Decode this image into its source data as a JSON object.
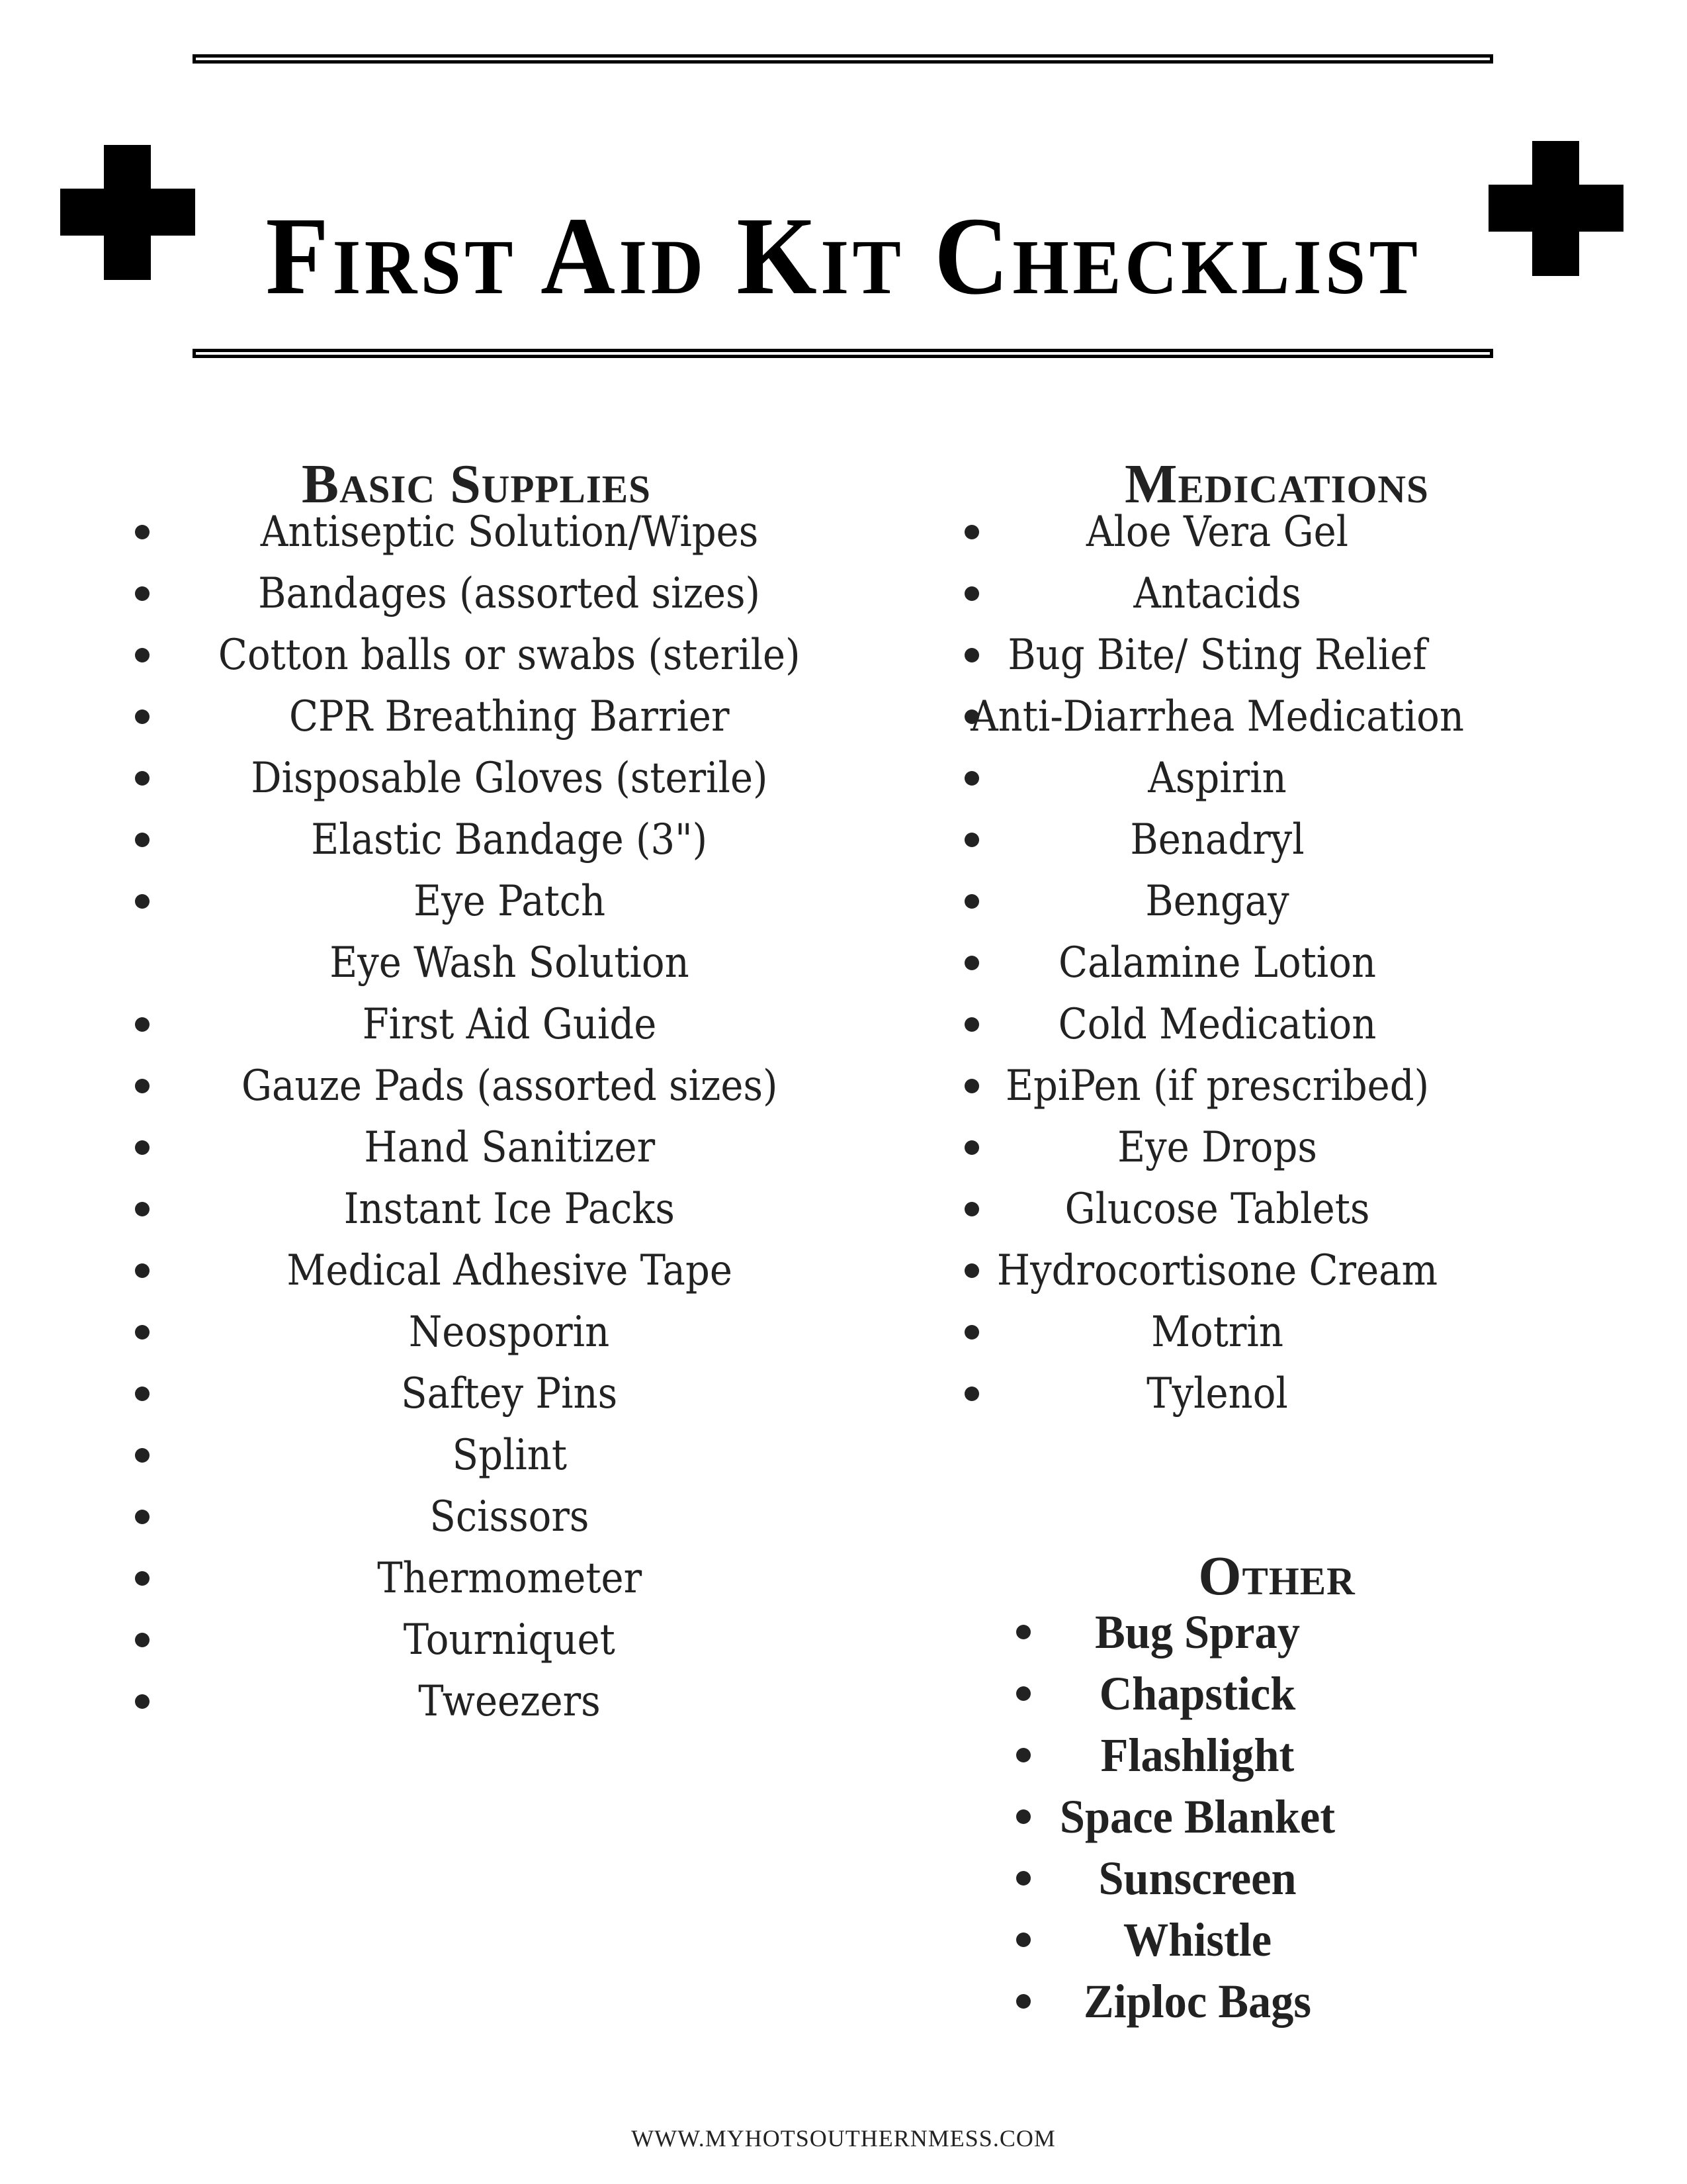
{
  "document": {
    "title": "First Aid Kit Checklist",
    "footer_url": "WWW.MYHOTSOUTHERNMESS.COM",
    "icons": {
      "left": "cross-icon",
      "right": "cross-icon"
    }
  },
  "sections": {
    "basic_supplies": {
      "heading": "Basic Supplies",
      "items": [
        {
          "label": "Antiseptic Solution/Wipes",
          "bullet": true
        },
        {
          "label": "Bandages (assorted sizes)",
          "bullet": true
        },
        {
          "label": "Cotton balls or swabs (sterile)",
          "bullet": true
        },
        {
          "label": "CPR Breathing Barrier",
          "bullet": true
        },
        {
          "label": "Disposable Gloves (sterile)",
          "bullet": true
        },
        {
          "label": "Elastic Bandage (3\")",
          "bullet": true
        },
        {
          "label": "Eye Patch",
          "bullet": true
        },
        {
          "label": "Eye Wash Solution",
          "bullet": false
        },
        {
          "label": "First Aid Guide",
          "bullet": true
        },
        {
          "label": "Gauze Pads (assorted sizes)",
          "bullet": true
        },
        {
          "label": "Hand Sanitizer",
          "bullet": true
        },
        {
          "label": "Instant Ice Packs",
          "bullet": true
        },
        {
          "label": "Medical Adhesive Tape",
          "bullet": true
        },
        {
          "label": "Neosporin",
          "bullet": true
        },
        {
          "label": "Saftey Pins",
          "bullet": true
        },
        {
          "label": "Splint",
          "bullet": true
        },
        {
          "label": "Scissors",
          "bullet": true
        },
        {
          "label": "Thermometer",
          "bullet": true
        },
        {
          "label": "Tourniquet",
          "bullet": true
        },
        {
          "label": "Tweezers",
          "bullet": true
        }
      ]
    },
    "medications": {
      "heading": "Medications",
      "items": [
        {
          "label": "Aloe Vera Gel",
          "bullet": true
        },
        {
          "label": "Antacids",
          "bullet": true
        },
        {
          "label": "Bug Bite/ Sting Relief",
          "bullet": true
        },
        {
          "label": "Anti-Diarrhea Medication",
          "bullet": true
        },
        {
          "label": "Aspirin",
          "bullet": true
        },
        {
          "label": "Benadryl",
          "bullet": true
        },
        {
          "label": "Bengay",
          "bullet": true
        },
        {
          "label": "Calamine Lotion",
          "bullet": true
        },
        {
          "label": "Cold Medication",
          "bullet": true
        },
        {
          "label": "EpiPen (if prescribed)",
          "bullet": true
        },
        {
          "label": "Eye Drops",
          "bullet": true
        },
        {
          "label": "Glucose Tablets",
          "bullet": true
        },
        {
          "label": "Hydrocortisone Cream",
          "bullet": true
        },
        {
          "label": "Motrin",
          "bullet": true
        },
        {
          "label": "Tylenol",
          "bullet": true
        }
      ]
    },
    "other": {
      "heading": "Other",
      "items": [
        {
          "label": "Bug Spray",
          "bullet": true
        },
        {
          "label": "Chapstick",
          "bullet": true
        },
        {
          "label": "Flashlight",
          "bullet": true
        },
        {
          "label": "Space Blanket",
          "bullet": true
        },
        {
          "label": "Sunscreen",
          "bullet": true
        },
        {
          "label": "Whistle",
          "bullet": true
        },
        {
          "label": "Ziploc Bags",
          "bullet": true
        }
      ]
    }
  }
}
